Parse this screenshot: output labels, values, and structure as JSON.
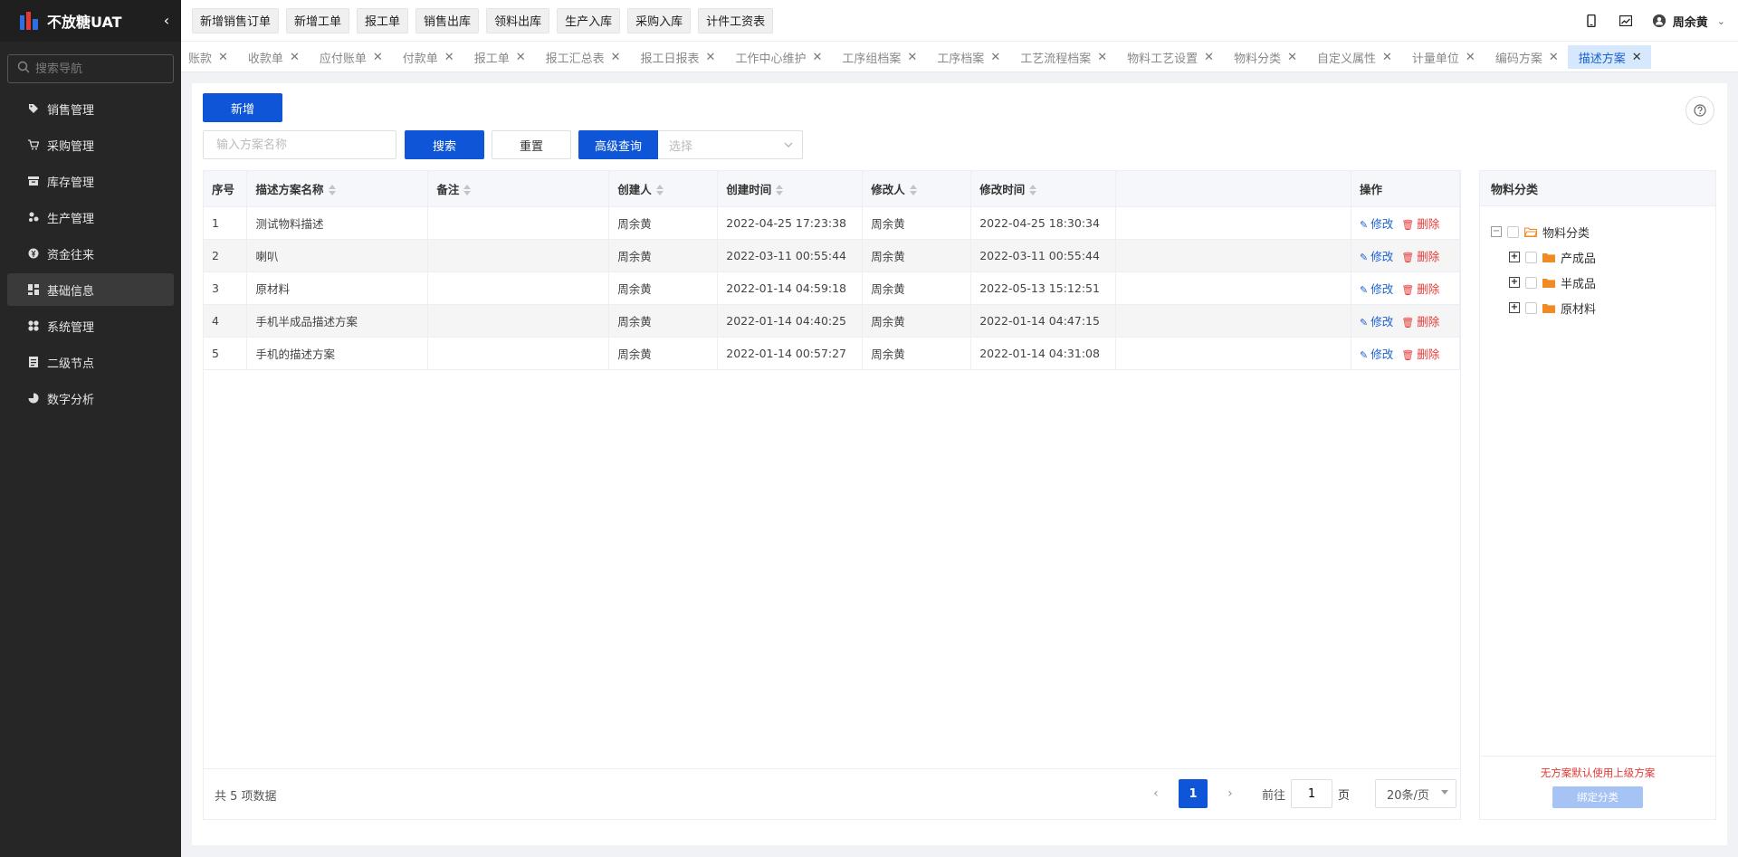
{
  "app": {
    "name": "不放糖UAT"
  },
  "sidebar": {
    "search_placeholder": "搜索导航",
    "items": [
      {
        "label": "销售管理",
        "icon": "tag-icon"
      },
      {
        "label": "采购管理",
        "icon": "cart-icon"
      },
      {
        "label": "库存管理",
        "icon": "inventory-icon"
      },
      {
        "label": "生产管理",
        "icon": "production-icon"
      },
      {
        "label": "资金往来",
        "icon": "money-icon"
      },
      {
        "label": "基础信息",
        "icon": "basic-info-icon",
        "active": true
      },
      {
        "label": "系统管理",
        "icon": "system-icon"
      },
      {
        "label": "二级节点",
        "icon": "node-icon"
      },
      {
        "label": "数字分析",
        "icon": "pie-chart-icon"
      }
    ]
  },
  "header": {
    "quick_actions": [
      "新增销售订单",
      "新增工单",
      "报工单",
      "销售出库",
      "领料出库",
      "生产入库",
      "采购入库",
      "计件工资表"
    ],
    "user_name": "周余黄"
  },
  "tabs": [
    {
      "label": "账款"
    },
    {
      "label": "收款单"
    },
    {
      "label": "应付账单"
    },
    {
      "label": "付款单"
    },
    {
      "label": "报工单"
    },
    {
      "label": "报工汇总表"
    },
    {
      "label": "报工日报表"
    },
    {
      "label": "工作中心维护"
    },
    {
      "label": "工序组档案"
    },
    {
      "label": "工序档案"
    },
    {
      "label": "工艺流程档案"
    },
    {
      "label": "物料工艺设置"
    },
    {
      "label": "物料分类"
    },
    {
      "label": "自定义属性"
    },
    {
      "label": "计量单位"
    },
    {
      "label": "编码方案"
    },
    {
      "label": "描述方案",
      "active": true
    }
  ],
  "toolbar": {
    "add_label": "新增",
    "search_placeholder": "输入方案名称",
    "search_label": "搜索",
    "reset_label": "重置",
    "advanced_label": "高级查询",
    "select_placeholder": "选择"
  },
  "table": {
    "columns": [
      "序号",
      "描述方案名称",
      "备注",
      "创建人",
      "创建时间",
      "修改人",
      "修改时间",
      "",
      "操作"
    ],
    "edit_label": "修改",
    "delete_label": "删除",
    "rows": [
      [
        "1",
        "测试物料描述",
        "",
        "周余黄",
        "2022-04-25 17:23:38",
        "周余黄",
        "2022-04-25 18:30:34"
      ],
      [
        "2",
        "喇叭",
        "",
        "周余黄",
        "2022-03-11 00:55:44",
        "周余黄",
        "2022-03-11 00:55:44"
      ],
      [
        "3",
        "原材料",
        "",
        "周余黄",
        "2022-01-14 04:59:18",
        "周余黄",
        "2022-05-13 15:12:51"
      ],
      [
        "4",
        "手机半成品描述方案",
        "",
        "周余黄",
        "2022-01-14 04:40:25",
        "周余黄",
        "2022-01-14 04:47:15"
      ],
      [
        "5",
        "手机的描述方案",
        "",
        "周余黄",
        "2022-01-14 00:57:27",
        "周余黄",
        "2022-01-14 04:31:08"
      ]
    ]
  },
  "pagination": {
    "total_text": "共 5 项数据",
    "current_page": "1",
    "goto_label": "前往",
    "goto_value": "1",
    "page_suffix": "页",
    "page_size": "20条/页"
  },
  "category_panel": {
    "title": "物料分类",
    "root": "物料分类",
    "children": [
      "产成品",
      "半成品",
      "原材料"
    ],
    "note": "无方案默认使用上级方案",
    "bind_label": "绑定分类"
  },
  "colors": {
    "primary": "#0e55d8",
    "sidebar_bg": "#262626",
    "danger": "#e53935",
    "folder": "#f08a24",
    "active_tab_bg": "#d6e8fb"
  }
}
